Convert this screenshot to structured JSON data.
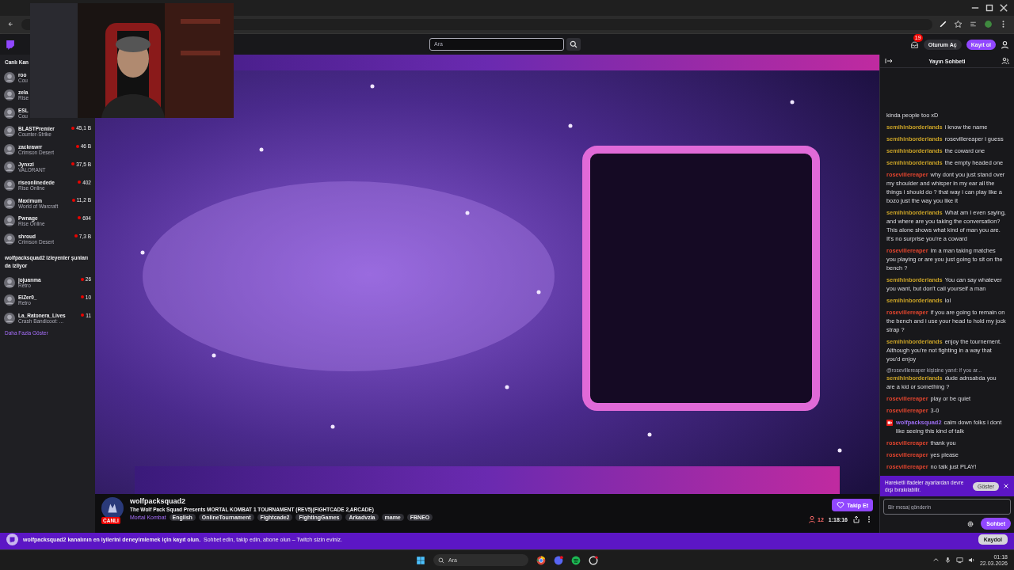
{
  "topnav": {
    "search_placeholder": "Ara",
    "inbox_badge": "19",
    "login": "Oturum Aç",
    "signup": "Kayıt ol"
  },
  "sidebar": {
    "header": "Canlı Kan",
    "channels": [
      {
        "name": "roo",
        "game": "Cou"
      },
      {
        "name": "zela",
        "game": "Rise"
      },
      {
        "name": "ESL",
        "game": "Cou"
      },
      {
        "name": "BLASTPremier",
        "game": "Counter-Strike",
        "viewers": "45,1 B"
      },
      {
        "name": "zackrawrr",
        "game": "Crimson Desert",
        "viewers": "46 B"
      },
      {
        "name": "Jynxzi",
        "game": "VALORANT",
        "viewers": "37,5 B"
      },
      {
        "name": "riseonlinedede",
        "game": "Rise Online",
        "viewers": "402"
      },
      {
        "name": "Maximum",
        "game": "World of Warcraft",
        "viewers": "11,2 B"
      },
      {
        "name": "Pwnage",
        "game": "Rise Online",
        "viewers": "694"
      },
      {
        "name": "shroud",
        "game": "Crimson Desert",
        "viewers": "7,3 B"
      }
    ],
    "related_header": "wolfpacksquad2 izleyenler şunları da izliyor",
    "related": [
      {
        "name": "jojuanma",
        "game": "Retro",
        "viewers": "26"
      },
      {
        "name": "ElZer0_",
        "game": "Retro",
        "viewers": "10"
      },
      {
        "name": "La_Ratonera_Lives",
        "game": "Crash Bandicoot: ...",
        "viewers": "11"
      }
    ],
    "show_more": "Daha Fazla Göster"
  },
  "stream": {
    "channel": "wolfpacksquad2",
    "title": "The Wolf Pack Squad Presents MORTAL KOMBAT 1 TOURNAMENT (REV5)(FIGHTCADE 2,ARCADE)",
    "live_badge": "CANLI",
    "category": "Mortal Kombat",
    "tags": [
      "English",
      "OnlineTournament",
      "Fightcade2",
      "FightingGames",
      "Arkadvzia",
      "mame",
      "FBNEO"
    ],
    "follow": "Takip Et",
    "viewers": "12",
    "uptime": "1:18:16"
  },
  "chat": {
    "title": "Yayın Sohbeti",
    "messages": [
      {
        "text": "kinda people too xD"
      },
      {
        "user": "semihinborderlands",
        "color": "#c9a227",
        "text": "i know the name"
      },
      {
        "user": "semihinborderlands",
        "color": "#c9a227",
        "text": "rosevillereaper i guess"
      },
      {
        "user": "semihinborderlands",
        "color": "#c9a227",
        "text": "the coward one"
      },
      {
        "user": "semihinborderlands",
        "color": "#c9a227",
        "text": "the empty headed one"
      },
      {
        "user": "rosevillereaper",
        "color": "#e0442e",
        "text": "why dont you just stand over my shoulder and whisper in my ear all the things i should do ? that way i can play like a bozo just the way you like it"
      },
      {
        "user": "semihinborderlands",
        "color": "#c9a227",
        "text": "What am I even saying, and where are you taking the conversation? This alone shows what kind of man you are. It's no surprise you're a coward"
      },
      {
        "user": "rosevillereaper",
        "color": "#e0442e",
        "text": "im a man taking matches you playing or are you just going to sit on the bench ?"
      },
      {
        "user": "semihinborderlands",
        "color": "#c9a227",
        "text": "You can say whatever you want, but don't call yourself a man"
      },
      {
        "user": "semihinborderlands",
        "color": "#c9a227",
        "text": "lol"
      },
      {
        "user": "rosevillereaper",
        "color": "#e0442e",
        "text": "if you are going to remain on the bench and i use your head to hold my jock strap ?"
      },
      {
        "user": "semihinborderlands",
        "color": "#c9a227",
        "text": "enjoy the tournement. Although you're not fighting in a way that you'd enjoy"
      },
      {
        "user": "semihinborderlands",
        "color": "#c9a227",
        "text": "dude adnsabda you are a kid or something ?",
        "reply": "@rosevillereaper kişisine yanıt: if you ar..."
      },
      {
        "user": "rosevillereaper",
        "color": "#e0442e",
        "text": "play or be quiet"
      },
      {
        "user": "rosevillereaper",
        "color": "#e0442e",
        "text": "3-0"
      },
      {
        "user": "wolfpacksquad2",
        "color": "#9b6cf0",
        "text": "calm down folks i dont like seeing this kind of talk",
        "kind": "broadcaster"
      },
      {
        "user": "rosevillereaper",
        "color": "#e0442e",
        "text": "thank you"
      },
      {
        "user": "rosevillereaper",
        "color": "#e0442e",
        "text": "yes please"
      },
      {
        "user": "rosevillereaper",
        "color": "#e0442e",
        "text": "no talk just PLAY!"
      }
    ],
    "notice": {
      "text": "Hareketli ifadeler ayarlardan devre dışı bırakılabilir.",
      "button": "Göster"
    },
    "input_placeholder": "Bir mesaj gönderin",
    "send": "Sohbet"
  },
  "banner": {
    "bold": "wolfpacksquad2 kanalının en iyilerini deneyimlemek için kayıt olun.",
    "text": "Sohbet edin, takip edin, abone olun – Twitch sizin eviniz.",
    "button": "Kaydol"
  },
  "taskbar": {
    "search_placeholder": "Ara",
    "time": "01:18",
    "date": "22.03.2026"
  }
}
